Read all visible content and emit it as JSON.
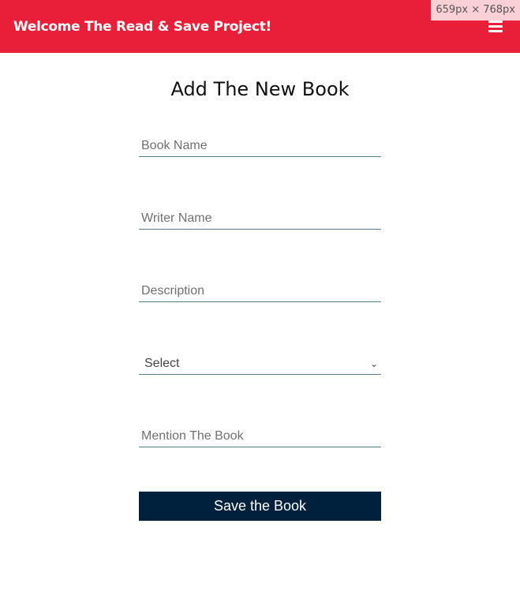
{
  "header": {
    "title": "Welcome The Read & Save Project!",
    "menu_icon": "hamburger-icon"
  },
  "overlay": {
    "size_text": "659px × 768px"
  },
  "form": {
    "title": "Add The New Book",
    "book_name_placeholder": "Book Name",
    "writer_name_placeholder": "Writer Name",
    "description_placeholder": "Description",
    "select_value": "Select",
    "mention_placeholder": "Mention The Book",
    "save_label": "Save the Book"
  },
  "colors": {
    "header": "#e91e38",
    "button": "#00213e"
  }
}
